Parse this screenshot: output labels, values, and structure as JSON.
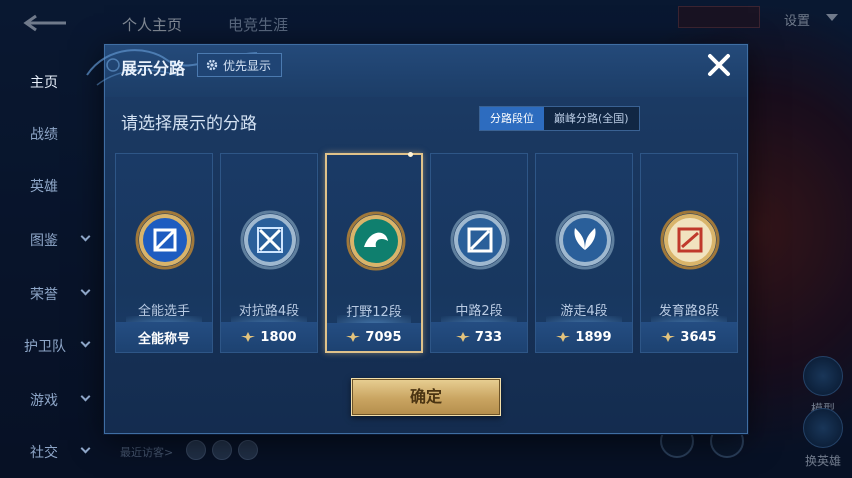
{
  "top_tabs": [
    "个人主页",
    "电竞生涯"
  ],
  "top_settings": "设置",
  "sidebar": [
    {
      "label": "主页",
      "chevron": false
    },
    {
      "label": "战绩",
      "chevron": false
    },
    {
      "label": "英雄",
      "chevron": false
    },
    {
      "label": "图鉴",
      "chevron": true
    },
    {
      "label": "荣誉",
      "chevron": true
    },
    {
      "label": "护卫队",
      "chevron": true
    },
    {
      "label": "游戏",
      "chevron": true
    },
    {
      "label": "社交",
      "chevron": true
    }
  ],
  "right_buttons": [
    "模型",
    "换英雄"
  ],
  "visitors_label": "最近访客>",
  "modal": {
    "title": "展示分路",
    "priority_label": "优先显示",
    "subtitle": "请选择展示的分路",
    "segments": [
      {
        "label": "分路段位",
        "active": true
      },
      {
        "label": "巅峰分路(全国)",
        "active": false
      }
    ],
    "cards": [
      {
        "name": "全能选手",
        "score": "全能称号",
        "show_star": false,
        "selected": false,
        "emblem": "allround-emblem-icon",
        "tier_color": "#d9b46a"
      },
      {
        "name": "对抗路4段",
        "score": "1800",
        "show_star": true,
        "selected": false,
        "emblem": "clash-lane-emblem-icon",
        "tier_color": "#9fb8cf"
      },
      {
        "name": "打野12段",
        "score": "7095",
        "show_star": true,
        "selected": true,
        "emblem": "jungle-emblem-icon",
        "tier_color": "#d9b46a"
      },
      {
        "name": "中路2段",
        "score": "733",
        "show_star": true,
        "selected": false,
        "emblem": "mid-lane-emblem-icon",
        "tier_color": "#9fb8cf"
      },
      {
        "name": "游走4段",
        "score": "1899",
        "show_star": true,
        "selected": false,
        "emblem": "roam-emblem-icon",
        "tier_color": "#9fb8cf"
      },
      {
        "name": "发育路8段",
        "score": "3645",
        "show_star": true,
        "selected": false,
        "emblem": "farm-lane-emblem-icon",
        "tier_color": "#d9b46a"
      }
    ],
    "confirm_label": "确定"
  },
  "colors": {
    "accent_blue": "#2d6cbf",
    "gold": "#d9b46a",
    "modal_bg": "#173359"
  }
}
